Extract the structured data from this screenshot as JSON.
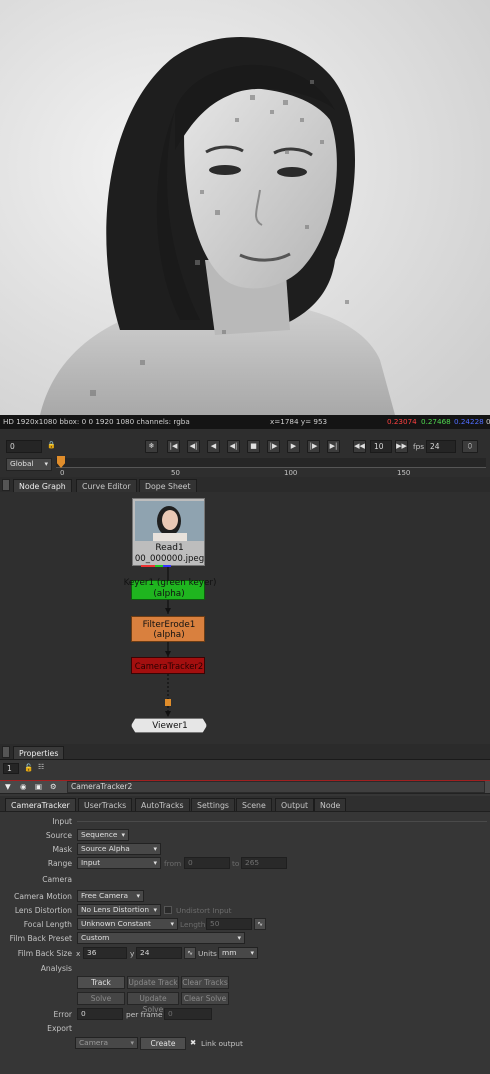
{
  "viewer": {
    "info_left": "HD 1920x1080 bbox: 0 0 1920 1080 channels: rgba",
    "info_coords": "x=1784 y= 953",
    "rgba": {
      "r": "0.23074",
      "g": "0.27468",
      "b": "0.24228",
      "a": "0"
    },
    "colors": {
      "r": "#ff4040",
      "g": "#4fd84f",
      "b": "#4f6cff"
    }
  },
  "transport": {
    "frame": "0",
    "global": "Global",
    "ruler_labels": [
      "0",
      "50",
      "100",
      "150"
    ],
    "skip": "10",
    "fps_label": "fps",
    "fps": "24"
  },
  "node_graph_tabs": [
    "Node Graph",
    "Curve Editor",
    "Dope Sheet"
  ],
  "nodes": {
    "read_name": "Read1",
    "read_file": "00_000000.jpeg",
    "keyer_title": "Keyer1 (green keyer)",
    "keyer_sub": "(alpha)",
    "filter_title": "FilterErode1",
    "filter_sub": "(alpha)",
    "tracker_title": "CameraTracker2",
    "viewer_title": "Viewer1"
  },
  "properties": {
    "pane_title": "Properties",
    "count": "1",
    "node_name": "CameraTracker2",
    "tabs": [
      "CameraTracker",
      "UserTracks",
      "AutoTracks",
      "Settings",
      "Scene",
      "Output",
      "Node"
    ],
    "input_header": "Input",
    "source_label": "Source",
    "source_value": "Sequence",
    "mask_label": "Mask",
    "mask_value": "Source Alpha",
    "range_label": "Range",
    "range_value": "Input",
    "from_label": "from",
    "from_value": "0",
    "to_label": "to",
    "to_value": "265",
    "camera_header": "Camera",
    "camera_motion_label": "Camera Motion",
    "camera_motion_value": "Free Camera",
    "lens_distortion_label": "Lens Distortion",
    "lens_distortion_value": "No Lens Distortion",
    "undistort_label": "Undistort Input",
    "focal_length_label": "Focal Length",
    "focal_length_value": "Unknown Constant",
    "length_label": "Length",
    "length_value": "50",
    "film_back_preset_label": "Film Back Preset",
    "film_back_preset_value": "Custom",
    "film_back_size_label": "Film Back Size",
    "x_label": "x",
    "x_value": "36",
    "y_label": "y",
    "y_value": "24",
    "units_label": "Units",
    "units_value": "mm",
    "analysis_header": "Analysis",
    "track_btn": "Track",
    "update_track_btn": "Update Track",
    "clear_tracks_btn": "Clear Tracks",
    "solve_btn": "Solve",
    "update_solve_btn": "Update Solve",
    "clear_solve_btn": "Clear Solve",
    "error_label": "Error",
    "error_value": "0",
    "per_frame_label": "per frame",
    "per_frame_value": "0",
    "export_header": "Export",
    "export_value": "Camera",
    "create_btn": "Create",
    "link_output_label": "Link output"
  }
}
